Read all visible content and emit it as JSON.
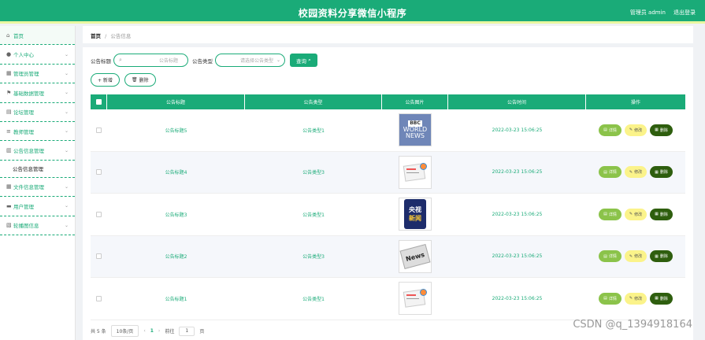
{
  "header": {
    "title": "校园资料分享微信小程序",
    "admin": "管理员 admin",
    "logout": "退出登录"
  },
  "sidebar": {
    "items": [
      {
        "label": "首页",
        "icon": "home-icon",
        "chev": false
      },
      {
        "label": "个人中心",
        "icon": "user-icon",
        "chev": true
      },
      {
        "label": "管理员管理",
        "icon": "grid-icon",
        "chev": true
      },
      {
        "label": "基础数据管理",
        "icon": "flag-icon",
        "chev": true
      },
      {
        "label": "论坛管理",
        "icon": "doc-icon",
        "chev": true
      },
      {
        "label": "教师管理",
        "icon": "list-icon",
        "chev": true
      },
      {
        "label": "公告信息管理",
        "icon": "bank-icon",
        "chev": true
      }
    ],
    "sub": "公告信息管理",
    "items2": [
      {
        "label": "文件信息管理",
        "icon": "grid-icon",
        "chev": true
      },
      {
        "label": "用户管理",
        "icon": "chat-icon",
        "chev": true
      },
      {
        "label": "轮播图信息",
        "icon": "chart-icon",
        "chev": true
      }
    ]
  },
  "breadcrumb": {
    "home": "首页",
    "sep": "/",
    "current": "公告信息"
  },
  "filter": {
    "title_label": "公告标题",
    "title_placeholder": "公告标题",
    "type_label": "公告类型",
    "type_placeholder": "请选择公告类型",
    "query_label": "查询"
  },
  "actions": {
    "add": "+ 新增",
    "delete": "删除"
  },
  "table": {
    "headers": [
      "公告标题",
      "公告类型",
      "公告图片",
      "公告时间",
      "操作"
    ],
    "rows": [
      {
        "title": "公告标题5",
        "type": "公告类型1",
        "img": "bbc",
        "time": "2022-03-23 15:06:25"
      },
      {
        "title": "公告标题4",
        "type": "公告类型3",
        "img": "paper",
        "time": "2022-03-23 15:06:25"
      },
      {
        "title": "公告标题3",
        "type": "公告类型1",
        "img": "cctv",
        "time": "2022-03-23 15:06:25"
      },
      {
        "title": "公告标题2",
        "type": "公告类型3",
        "img": "news",
        "time": "2022-03-23 15:06:25"
      },
      {
        "title": "公告标题1",
        "type": "公告类型1",
        "img": "paper",
        "time": "2022-03-23 15:06:25"
      }
    ],
    "ops": {
      "view": "详情",
      "edit": "修改",
      "del": "删除"
    }
  },
  "pager": {
    "total": "共 5 条",
    "size": "10条/页",
    "page": "1",
    "goto": "前往",
    "goto_val": "1",
    "unit": "页"
  },
  "watermark": "CSDN @q_1394918164",
  "thumb_text": {
    "bbc": [
      "BBC",
      "WORLD",
      "NEWS"
    ],
    "cctv": [
      "央视",
      "新闻"
    ],
    "news": "News"
  },
  "colors": {
    "accent": "#1aab78",
    "view": "#8bc34a",
    "edit": "#fbf38a",
    "del": "#2e5e0e"
  }
}
